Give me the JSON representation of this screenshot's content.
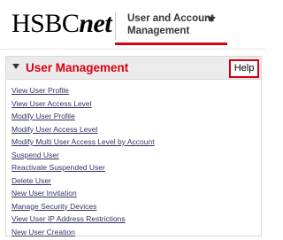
{
  "header": {
    "logo_main": "HSBC",
    "logo_suffix": "net",
    "nav_menu_label": "User and Account Management"
  },
  "panel": {
    "title": "User Management",
    "help_label": "Help",
    "links": [
      "View User Profile",
      "View User Access Level",
      "Modify User Profile",
      "Modify User Access Level",
      "Modify Multi User Access Level by Account",
      "Suspend User",
      "Reactivate Suspended User",
      "Delete User",
      "New User Invitation",
      "Manage Security Devices",
      "View User IP Address Restrictions",
      "New User Creation"
    ]
  },
  "colors": {
    "brand_red": "#db0011",
    "link": "#333366",
    "panel_header_bg": "#ebebeb"
  },
  "icons": {
    "nav_menu": "chevron-down-icon",
    "panel_toggle": "collapse-triangle-icon"
  }
}
